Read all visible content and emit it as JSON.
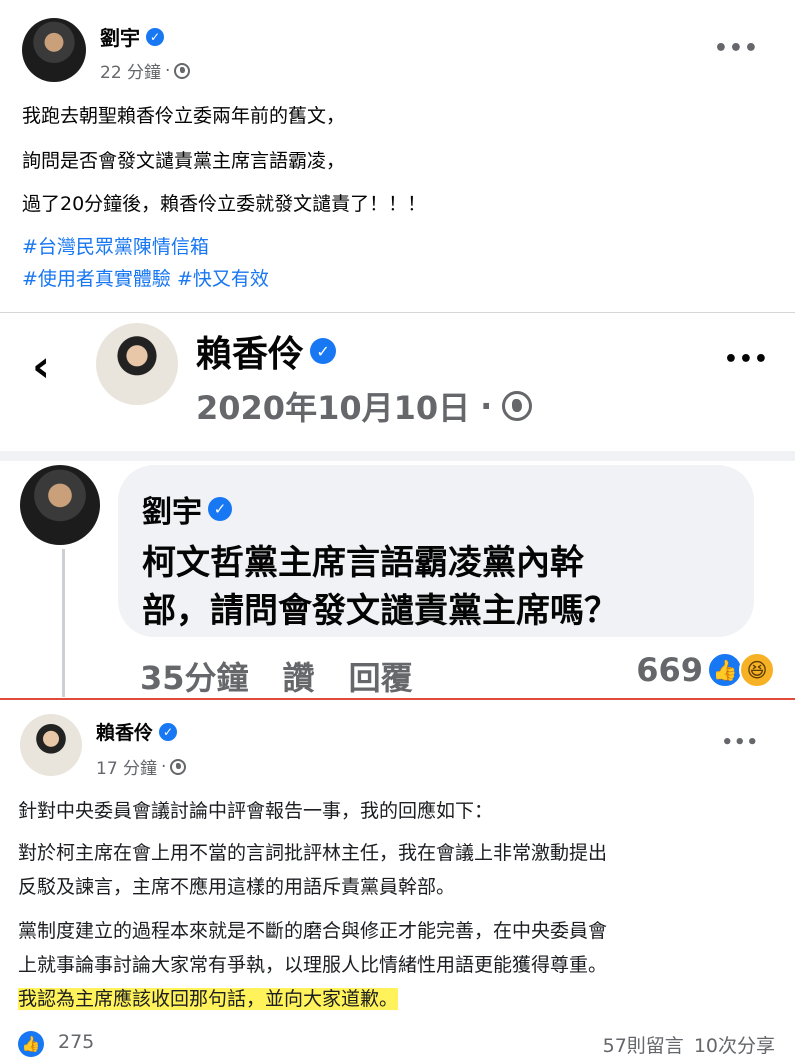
{
  "post": {
    "author": "劉宇",
    "time": "22 分鐘",
    "lines": [
      "我跑去朝聖賴香伶立委兩年前的舊文，",
      "詢問是否會發文譴責黨主席言語霸凌，",
      "過了20分鐘後，賴香伶立委就發文譴責了！！！"
    ],
    "hashtags": [
      "#台灣民眾黨陳情信箱",
      "#使用者真實體驗",
      "#快又有效"
    ]
  },
  "embed": {
    "page_name": "賴香伶",
    "date": "2020年10月10日",
    "comment": {
      "author": "劉宇",
      "text_line1": "柯文哲黨主席言語霸凌黨內幹",
      "text_line2": "部，請問會發文譴責黨主席嗎？",
      "time": "35分鐘",
      "like_label": "讚",
      "reply_label": "回覆",
      "reaction_count": "669"
    }
  },
  "reply_post": {
    "author": "賴香伶",
    "time": "17 分鐘",
    "paragraphs": [
      "針對中央委員會議討論中評會報告一事，我的回應如下：",
      "對於柯主席在會上用不當的言詞批評林主任，我在會議上非常激動提出",
      "反駁及諫言，主席不應用這樣的用語斥責黨員幹部。",
      "黨制度建立的過程本來就是不斷的磨合與修正才能完善，在中央委員會",
      "上就事論事討論大家常有爭執，以理服人比情緒性用語更能獲得尊重。",
      "我認為主席應該收回那句話，並向大家道歉。"
    ],
    "likes": "275",
    "comments": "57則留言",
    "shares": "10次分享"
  },
  "icons": {
    "verified": "verified-badge-icon",
    "globe": "globe-icon",
    "more": "more-options-icon",
    "back": "back-arrow-icon",
    "like": "like-icon",
    "haha": "haha-icon"
  },
  "colors": {
    "brand": "#1877f2",
    "highlight": "#fff25a",
    "secondary_text": "#65676b"
  }
}
